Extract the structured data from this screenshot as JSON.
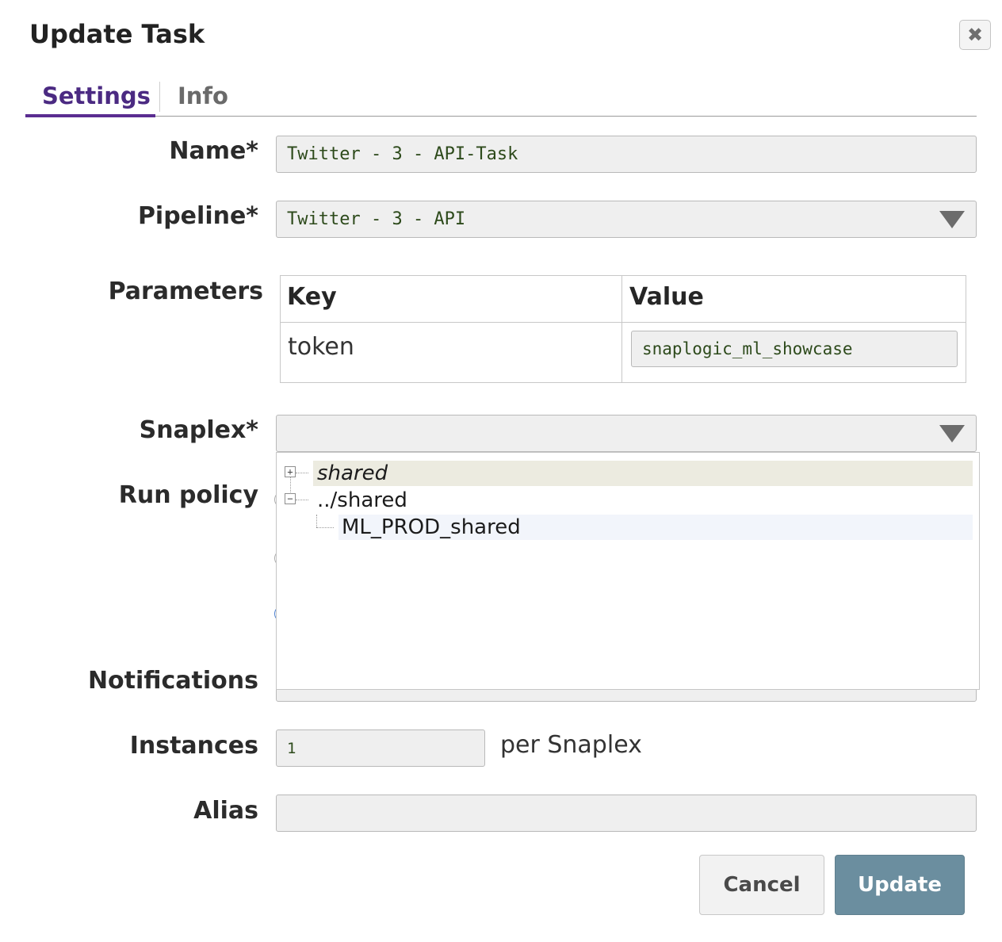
{
  "dialog": {
    "title": "Update Task",
    "close_glyph": "✖"
  },
  "tabs": [
    {
      "label": "Settings",
      "active": true
    },
    {
      "label": "Info",
      "active": false
    }
  ],
  "form": {
    "name": {
      "label": "Name*",
      "value": "Twitter - 3 - API-Task"
    },
    "pipeline": {
      "label": "Pipeline*",
      "value": "Twitter - 3 - API"
    },
    "parameters": {
      "label": "Parameters",
      "columns": [
        "Key",
        "Value"
      ],
      "rows": [
        {
          "key": "token",
          "value": "snaplogic_ml_showcase"
        }
      ]
    },
    "snaplex": {
      "label": "Snaplex*",
      "value": "",
      "tree": [
        {
          "label": "shared",
          "expander": "+",
          "level": 0,
          "highlighted": true
        },
        {
          "label": "../shared",
          "expander": "−",
          "level": 0,
          "highlighted": false
        },
        {
          "label": "ML_PROD_shared",
          "expander": "",
          "level": 1,
          "hovered": true
        }
      ]
    },
    "run_policy": {
      "label": "Run policy"
    },
    "notifications": {
      "label": "Notifications"
    },
    "instances": {
      "label": "Instances",
      "value": "1",
      "suffix": "per Snaplex"
    },
    "alias": {
      "label": "Alias",
      "value": ""
    }
  },
  "buttons": {
    "cancel": "Cancel",
    "update": "Update"
  },
  "colors": {
    "accent": "#5a2d91",
    "update_button": "#6b8e9f",
    "field_bg": "#efefef",
    "mono_text": "#2d4a1b"
  },
  "icons": {
    "close": "close-icon",
    "dropdown": "triangle-down-icon",
    "tree_expand": "plus-box-icon",
    "tree_collapse": "minus-box-icon"
  }
}
